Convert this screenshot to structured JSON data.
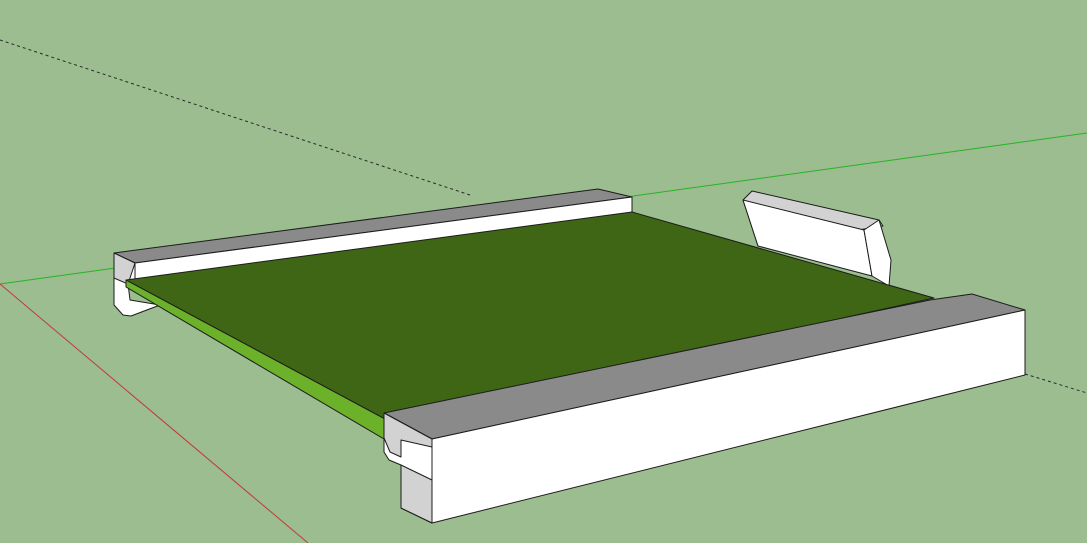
{
  "viewport": {
    "background_color": "#9bbd8f",
    "axes": {
      "red_color": "#c23a3a",
      "green_color": "#27b327",
      "dashed_color": "#2a2a2a"
    },
    "model": {
      "panel_top_color": "#3f6615",
      "panel_edge_color": "#6cb12a",
      "frame_face_color": "#ffffff",
      "frame_top_color": "#8a8a8a",
      "frame_shade_color": "#d2d2d2",
      "frame_stroke_color": "#1c1c1c"
    }
  }
}
